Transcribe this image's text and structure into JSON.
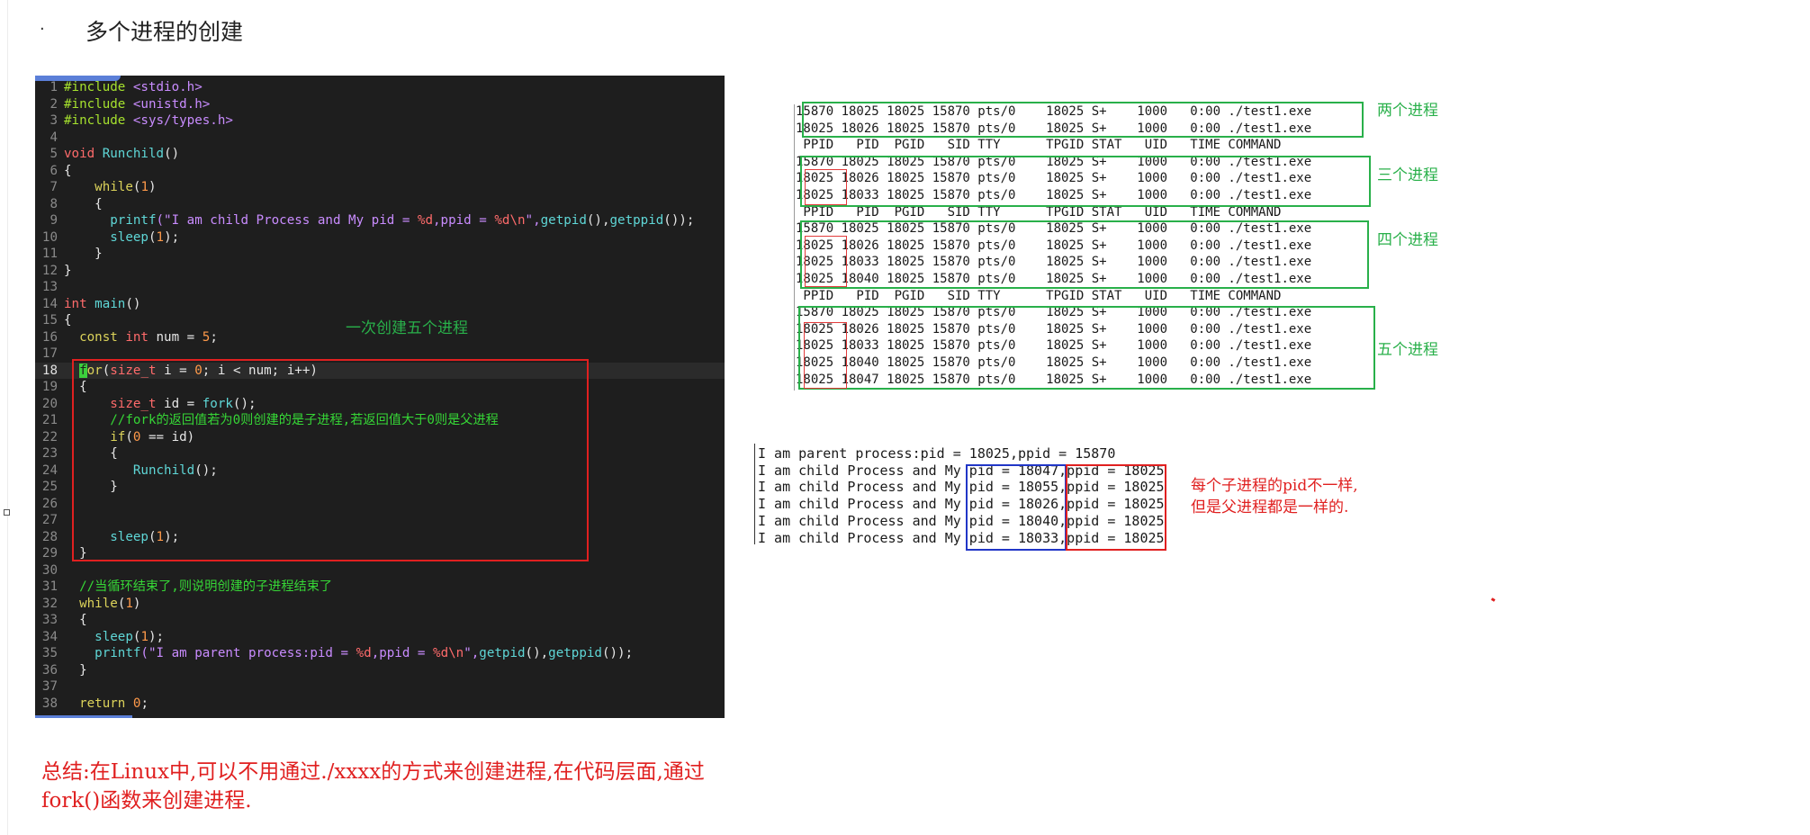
{
  "heading": {
    "bullet": "·",
    "title": "多个进程的创建"
  },
  "editor": {
    "cursor_line": 18,
    "lines": [
      [
        {
          "t": "#include ",
          "c": "pp"
        },
        {
          "t": "<stdio.h>",
          "c": "str"
        }
      ],
      [
        {
          "t": "#include ",
          "c": "pp"
        },
        {
          "t": "<unistd.h>",
          "c": "str"
        }
      ],
      [
        {
          "t": "#include ",
          "c": "pp"
        },
        {
          "t": "<sys/types.h>",
          "c": "str"
        }
      ],
      [],
      [
        {
          "t": "void ",
          "c": "ty"
        },
        {
          "t": "Runchild",
          "c": "fn"
        },
        {
          "t": "()",
          "c": "plain"
        }
      ],
      [
        {
          "t": "{",
          "c": "plain"
        }
      ],
      [
        {
          "t": "    ",
          "c": "plain"
        },
        {
          "t": "while",
          "c": "kw"
        },
        {
          "t": "(",
          "c": "plain"
        },
        {
          "t": "1",
          "c": "num"
        },
        {
          "t": ")",
          "c": "plain"
        }
      ],
      [
        {
          "t": "    {",
          "c": "plain"
        }
      ],
      [
        {
          "t": "      ",
          "c": "plain"
        },
        {
          "t": "printf",
          "c": "fn"
        },
        {
          "t": "(\"I am child Process and My pid = ",
          "c": "str"
        },
        {
          "t": "%d",
          "c": "fmt"
        },
        {
          "t": ",ppid = ",
          "c": "str"
        },
        {
          "t": "%d\\n",
          "c": "fmt"
        },
        {
          "t": "\",",
          "c": "str"
        },
        {
          "t": "getpid",
          "c": "fn"
        },
        {
          "t": "(),",
          "c": "plain"
        },
        {
          "t": "getppid",
          "c": "fn"
        },
        {
          "t": "());",
          "c": "plain"
        }
      ],
      [
        {
          "t": "      ",
          "c": "plain"
        },
        {
          "t": "sleep",
          "c": "fn"
        },
        {
          "t": "(",
          "c": "plain"
        },
        {
          "t": "1",
          "c": "num"
        },
        {
          "t": ");",
          "c": "plain"
        }
      ],
      [
        {
          "t": "    }",
          "c": "plain"
        }
      ],
      [
        {
          "t": "}",
          "c": "plain"
        }
      ],
      [],
      [
        {
          "t": "int ",
          "c": "ty"
        },
        {
          "t": "main",
          "c": "fn"
        },
        {
          "t": "()",
          "c": "plain"
        }
      ],
      [
        {
          "t": "{",
          "c": "plain"
        }
      ],
      [
        {
          "t": "  ",
          "c": "plain"
        },
        {
          "t": "const ",
          "c": "kw"
        },
        {
          "t": "int ",
          "c": "ty"
        },
        {
          "t": "num = ",
          "c": "plain"
        },
        {
          "t": "5",
          "c": "num"
        },
        {
          "t": ";",
          "c": "plain"
        }
      ],
      [],
      [
        {
          "t": "  ",
          "c": "plain"
        },
        {
          "t": "f",
          "c": "cursor"
        },
        {
          "t": "or",
          "c": "kw"
        },
        {
          "t": "(",
          "c": "plain"
        },
        {
          "t": "size_t",
          "c": "ty"
        },
        {
          "t": " i = ",
          "c": "plain"
        },
        {
          "t": "0",
          "c": "num"
        },
        {
          "t": "; i < num; i++)",
          "c": "plain"
        }
      ],
      [
        {
          "t": "  {",
          "c": "plain"
        }
      ],
      [
        {
          "t": "      ",
          "c": "plain"
        },
        {
          "t": "size_t",
          "c": "ty"
        },
        {
          "t": " id = ",
          "c": "plain"
        },
        {
          "t": "fork",
          "c": "fn"
        },
        {
          "t": "();",
          "c": "plain"
        }
      ],
      [
        {
          "t": "      //fork的返回值若为0则创建的是子进程,若返回值大于0则是父进程",
          "c": "cm"
        }
      ],
      [
        {
          "t": "      ",
          "c": "plain"
        },
        {
          "t": "if",
          "c": "kw"
        },
        {
          "t": "(",
          "c": "plain"
        },
        {
          "t": "0",
          "c": "num"
        },
        {
          "t": " == id)",
          "c": "plain"
        }
      ],
      [
        {
          "t": "      {",
          "c": "plain"
        }
      ],
      [
        {
          "t": "         ",
          "c": "plain"
        },
        {
          "t": "Runchild",
          "c": "fn"
        },
        {
          "t": "();",
          "c": "plain"
        }
      ],
      [
        {
          "t": "      }",
          "c": "plain"
        }
      ],
      [],
      [],
      [
        {
          "t": "      ",
          "c": "plain"
        },
        {
          "t": "sleep",
          "c": "fn"
        },
        {
          "t": "(",
          "c": "plain"
        },
        {
          "t": "1",
          "c": "num"
        },
        {
          "t": ");",
          "c": "plain"
        }
      ],
      [
        {
          "t": "  }",
          "c": "plain"
        }
      ],
      [],
      [
        {
          "t": "  //当循环结束了,则说明创建的子进程结束了",
          "c": "cm"
        }
      ],
      [
        {
          "t": "  ",
          "c": "plain"
        },
        {
          "t": "while",
          "c": "kw"
        },
        {
          "t": "(",
          "c": "plain"
        },
        {
          "t": "1",
          "c": "num"
        },
        {
          "t": ")",
          "c": "plain"
        }
      ],
      [
        {
          "t": "  {",
          "c": "plain"
        }
      ],
      [
        {
          "t": "    ",
          "c": "plain"
        },
        {
          "t": "sleep",
          "c": "fn"
        },
        {
          "t": "(",
          "c": "plain"
        },
        {
          "t": "1",
          "c": "num"
        },
        {
          "t": ");",
          "c": "plain"
        }
      ],
      [
        {
          "t": "    ",
          "c": "plain"
        },
        {
          "t": "printf",
          "c": "fn"
        },
        {
          "t": "(\"I am parent process:pid = ",
          "c": "str"
        },
        {
          "t": "%d",
          "c": "fmt"
        },
        {
          "t": ",ppid = ",
          "c": "str"
        },
        {
          "t": "%d\\n",
          "c": "fmt"
        },
        {
          "t": "\",",
          "c": "str"
        },
        {
          "t": "getpid",
          "c": "fn"
        },
        {
          "t": "(),",
          "c": "plain"
        },
        {
          "t": "getppid",
          "c": "fn"
        },
        {
          "t": "());",
          "c": "plain"
        }
      ],
      [
        {
          "t": "  }",
          "c": "plain"
        }
      ],
      [],
      [
        {
          "t": "  ",
          "c": "plain"
        },
        {
          "t": "return ",
          "c": "kw"
        },
        {
          "t": "0",
          "c": "num"
        },
        {
          "t": ";",
          "c": "plain"
        }
      ]
    ]
  },
  "annotations": {
    "loop_note": "一次创建五个进程",
    "summary": "总结:在Linux中,可以不用通过./xxxx的方式来创建进程,在代码层面,通过fork()函数来创建进程."
  },
  "ps_output": {
    "lines": [
      "15870 18025 18025 15870 pts/0    18025 S+    1000   0:00 ./test1.exe",
      "18025 18026 18025 15870 pts/0    18025 S+    1000   0:00 ./test1.exe",
      " PPID   PID  PGID   SID TTY      TPGID STAT   UID   TIME COMMAND",
      "15870 18025 18025 15870 pts/0    18025 S+    1000   0:00 ./test1.exe",
      "18025 18026 18025 15870 pts/0    18025 S+    1000   0:00 ./test1.exe",
      "18025 18033 18025 15870 pts/0    18025 S+    1000   0:00 ./test1.exe",
      " PPID   PID  PGID   SID TTY      TPGID STAT   UID   TIME COMMAND",
      "15870 18025 18025 15870 pts/0    18025 S+    1000   0:00 ./test1.exe",
      "18025 18026 18025 15870 pts/0    18025 S+    1000   0:00 ./test1.exe",
      "18025 18033 18025 15870 pts/0    18025 S+    1000   0:00 ./test1.exe",
      "18025 18040 18025 15870 pts/0    18025 S+    1000   0:00 ./test1.exe",
      " PPID   PID  PGID   SID TTY      TPGID STAT   UID   TIME COMMAND",
      "15870 18025 18025 15870 pts/0    18025 S+    1000   0:00 ./test1.exe",
      "18025 18026 18025 15870 pts/0    18025 S+    1000   0:00 ./test1.exe",
      "18025 18033 18025 15870 pts/0    18025 S+    1000   0:00 ./test1.exe",
      "18025 18040 18025 15870 pts/0    18025 S+    1000   0:00 ./test1.exe",
      "18025 18047 18025 15870 pts/0    18025 S+    1000   0:00 ./test1.exe"
    ],
    "group_labels": [
      "两个进程",
      "三个进程",
      "四个进程",
      "五个进程"
    ]
  },
  "program_output": {
    "lines": [
      "I am parent process:pid = 18025,ppid = 15870",
      "I am child Process and My pid = 18047,ppid = 18025",
      "I am child Process and My pid = 18055,ppid = 18025",
      "I am child Process and My pid = 18026,ppid = 18025",
      "I am child Process and My pid = 18040,ppid = 18025",
      "I am child Process and My pid = 18033,ppid = 18025"
    ],
    "note_lines": [
      "每个子进程的pid不一样,",
      "但是父进程都是一样的."
    ]
  },
  "colors": {
    "box_green": "#29b04a",
    "box_red": "#e02020",
    "box_blue": "#2136c7",
    "editor_bg": "#1e1e1e"
  }
}
